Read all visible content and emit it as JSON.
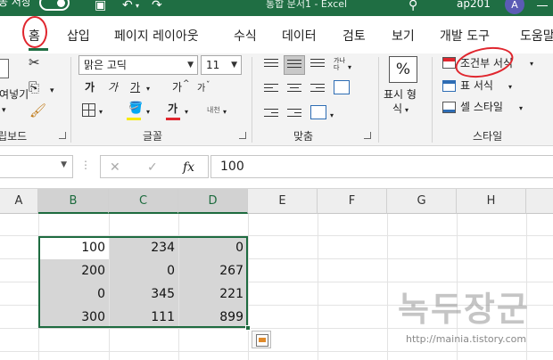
{
  "titlebar": {
    "autosave_label": "동 저장",
    "title": "통합 문서1 - Excel",
    "user": "ap201",
    "avatar_initial": "A"
  },
  "tabs": [
    "홈",
    "삽입",
    "페이지 레이아웃",
    "수식",
    "데이터",
    "검토",
    "보기",
    "개발 도구",
    "도움말"
  ],
  "ribbon": {
    "clipboard": {
      "paste_label": "붙여넣기",
      "group_label": "클립보드"
    },
    "font": {
      "font_name": "맑은 고딕",
      "font_size": "11",
      "bold": "가",
      "italic": "가",
      "underline": "가",
      "grow": "가",
      "shrink": "가",
      "fill_color_label": "가",
      "font_color_label": "가",
      "phonetic": "내천",
      "group_label": "글꼴"
    },
    "alignment": {
      "wrap_label": "가나다",
      "group_label": "맞춤"
    },
    "number": {
      "percent": "%",
      "label_line1": "표시 형",
      "label_line2": "식"
    },
    "styles": {
      "conditional": "조건부 서식",
      "table": "표 서식",
      "cell": "셀 스타일",
      "group_label": "스타일"
    }
  },
  "formula_bar": {
    "value": "100",
    "fx": "fx",
    "cancel": "✕",
    "enter": "✓"
  },
  "grid": {
    "columns": [
      "A",
      "B",
      "C",
      "D",
      "E",
      "F",
      "G",
      "H"
    ],
    "selected_columns": [
      "B",
      "C",
      "D"
    ],
    "rows": [
      [
        "100",
        "234",
        "0"
      ],
      [
        "200",
        "0",
        "267"
      ],
      [
        "0",
        "345",
        "221"
      ],
      [
        "300",
        "111",
        "899"
      ]
    ]
  },
  "watermark": {
    "text": "녹두장군",
    "url": "http://mainia.tistory.com"
  },
  "colors": {
    "excel_green": "#1f6e43",
    "annotation_red": "#e0262e"
  }
}
